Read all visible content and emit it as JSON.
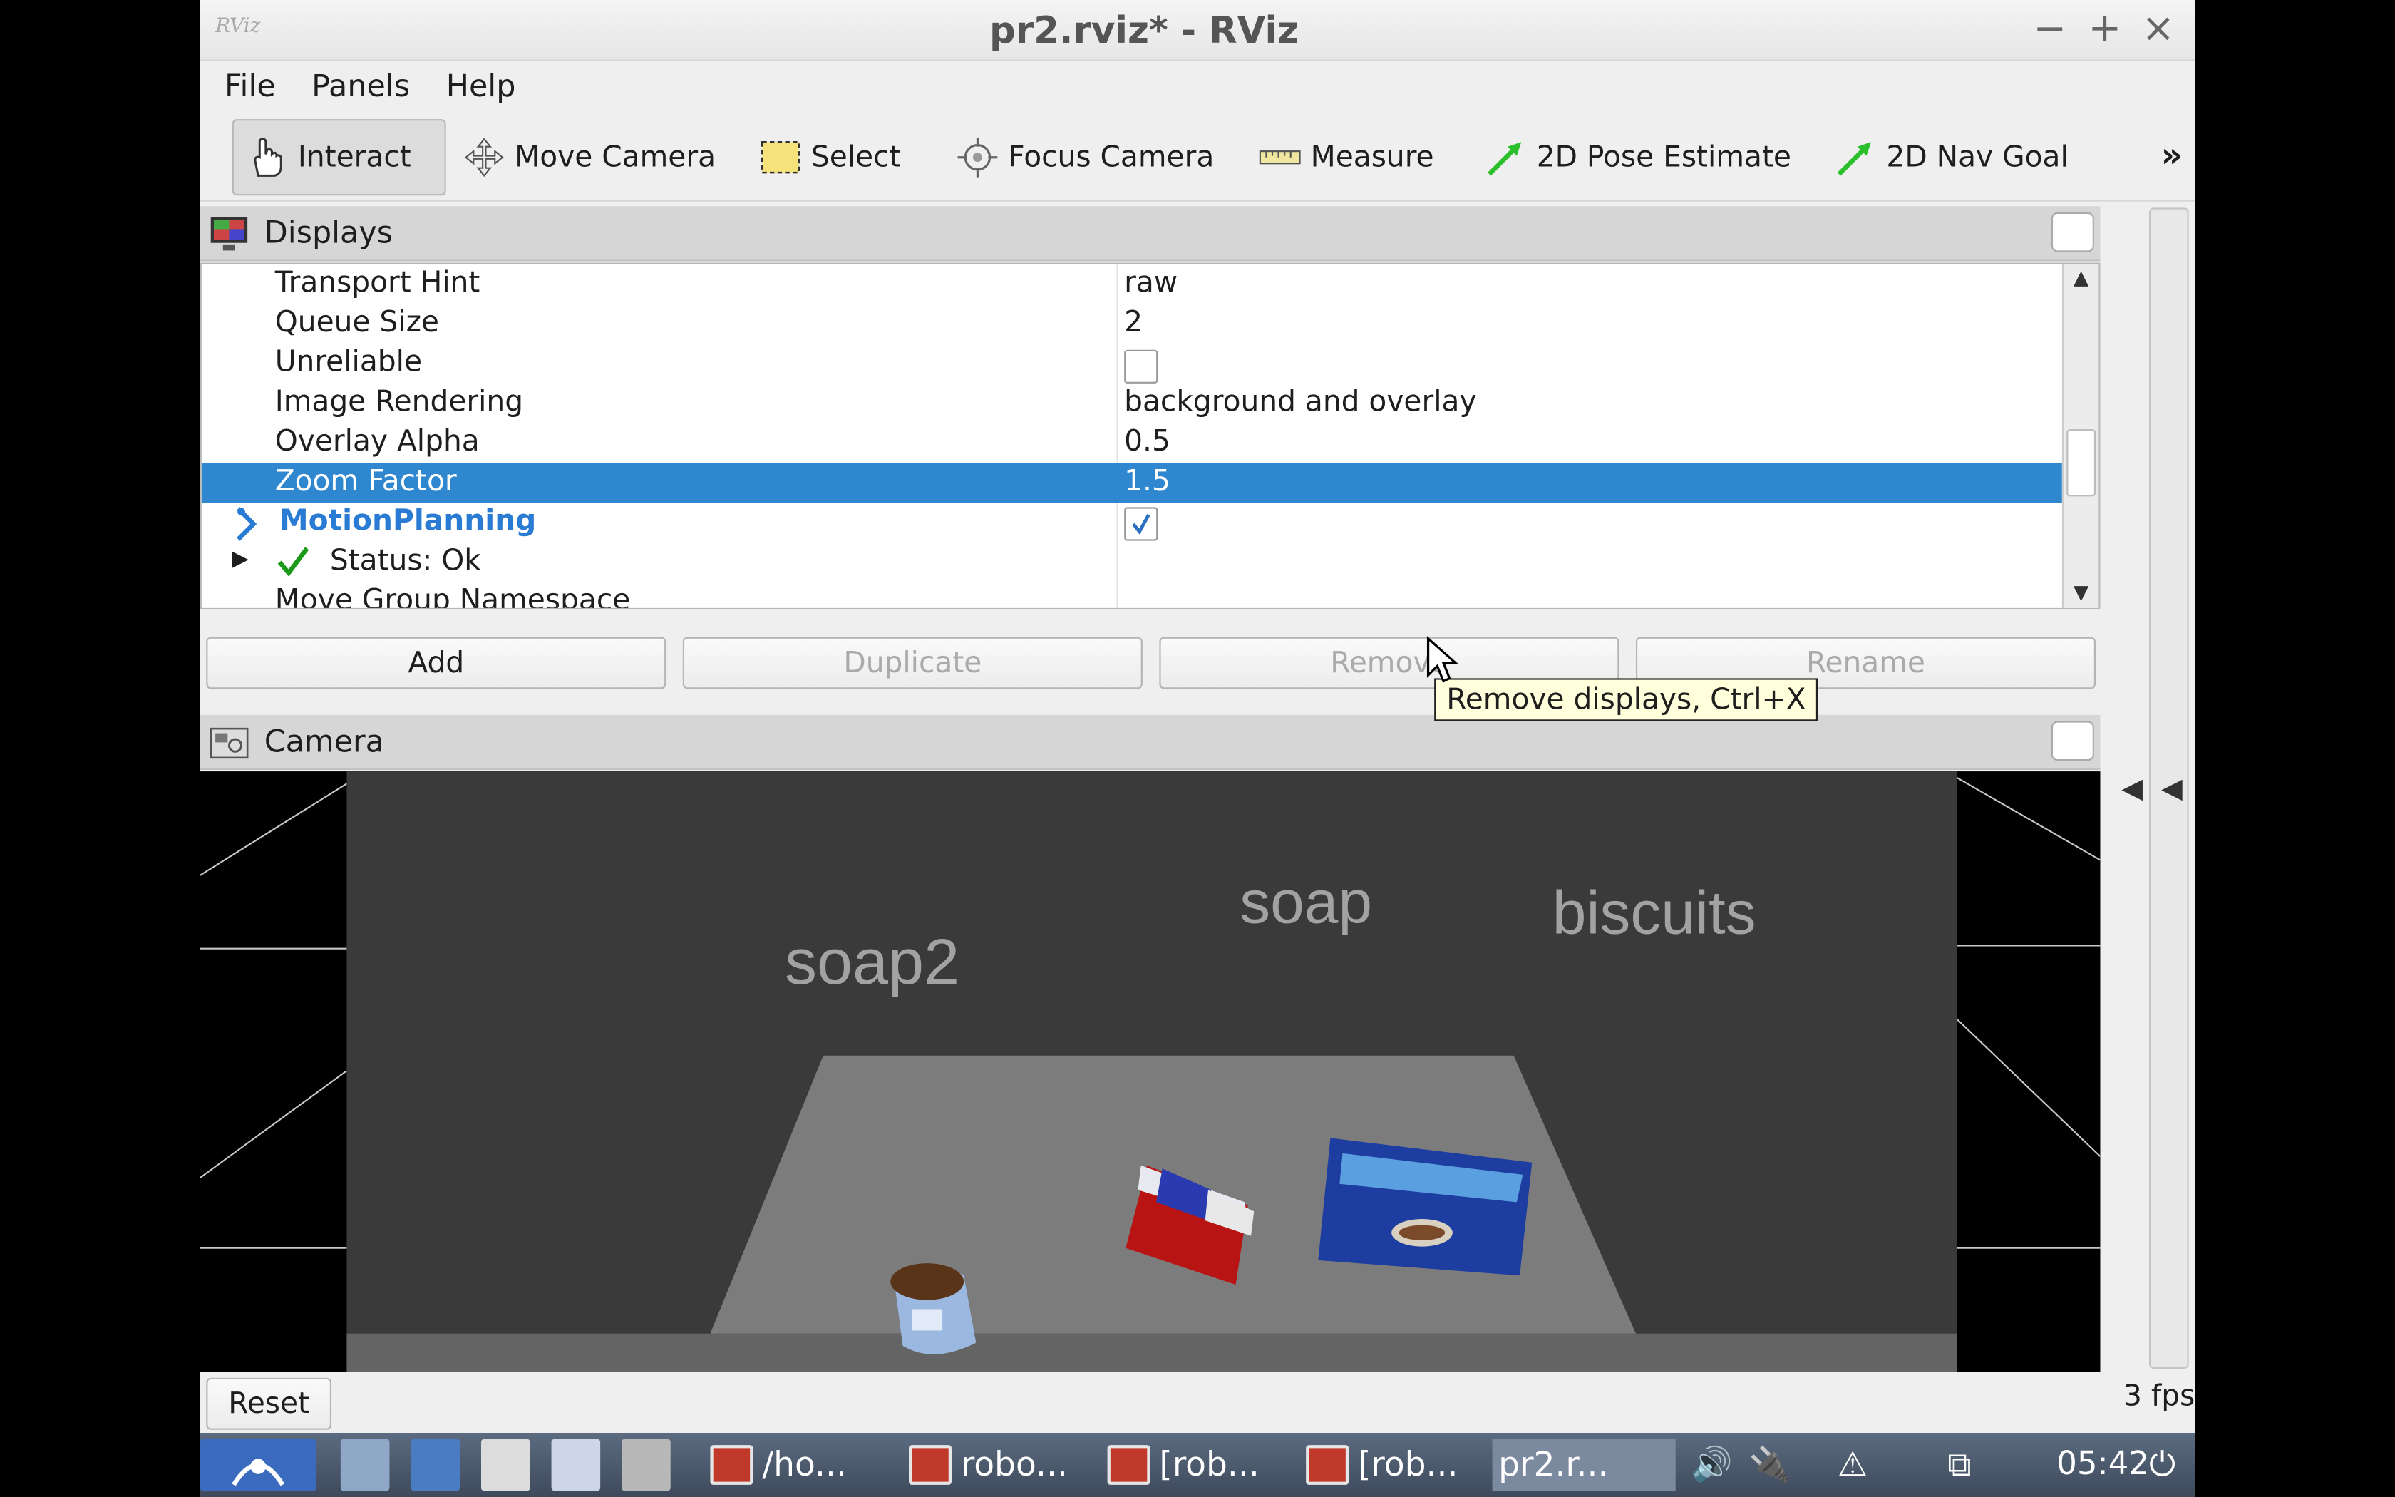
{
  "window": {
    "logo": "RViz",
    "title": "pr2.rviz* - RViz",
    "controls": {
      "minimize": "−",
      "maximize": "+",
      "close": "×"
    }
  },
  "menu": {
    "file": "File",
    "panels": "Panels",
    "help": "Help"
  },
  "toolbar": {
    "interact": "Interact",
    "move_camera": "Move Camera",
    "select": "Select",
    "focus_camera": "Focus Camera",
    "measure": "Measure",
    "pose_estimate": "2D Pose Estimate",
    "nav_goal": "2D Nav Goal",
    "more": "»"
  },
  "displays": {
    "title": "Displays",
    "rows": [
      {
        "label": "Transport Hint",
        "value": "raw"
      },
      {
        "label": "Queue Size",
        "value": "2"
      },
      {
        "label": "Unreliable",
        "value": ""
      },
      {
        "label": "Image Rendering",
        "value": "background and overlay"
      },
      {
        "label": "Overlay Alpha",
        "value": "0.5"
      },
      {
        "label": "Zoom Factor",
        "value": "1.5"
      },
      {
        "label": "MotionPlanning",
        "value": ""
      },
      {
        "label": "Status: Ok",
        "value": ""
      },
      {
        "label": "Move Group Namespace",
        "value": ""
      }
    ],
    "buttons": {
      "add": "Add",
      "duplicate": "Duplicate",
      "remove": "Remove",
      "rename": "Rename"
    },
    "tooltip": "Remove displays, Ctrl+X"
  },
  "camera": {
    "title": "Camera",
    "labels": {
      "soap2": "soap2",
      "soap": "soap",
      "biscuits": "biscuits"
    }
  },
  "status": {
    "reset": "Reset",
    "fps": "3 fps"
  },
  "taskbar": {
    "items": [
      "/ho...",
      "robo...",
      "[rob...",
      "[rob...",
      "pr2.r..."
    ],
    "clock": "05:42"
  },
  "colors": {
    "selection": "#2f88cf",
    "motion_planning": "#2a7bd3",
    "status_ok": "#1b9a1b"
  }
}
